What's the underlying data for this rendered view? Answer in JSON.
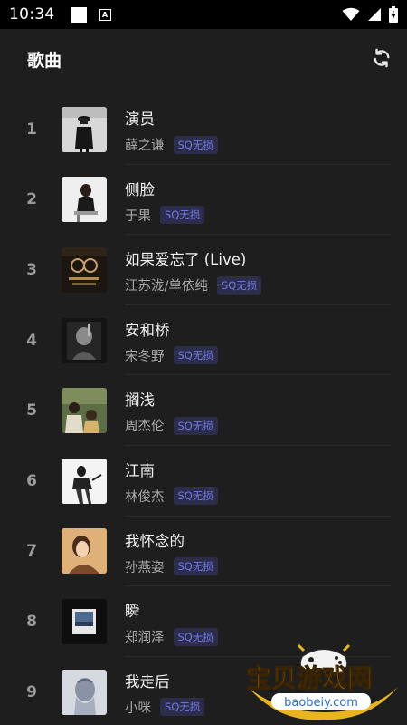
{
  "status_bar": {
    "time": "10:34",
    "notification_letter": "A"
  },
  "header": {
    "title": "歌曲",
    "refresh_icon": "refresh-icon"
  },
  "colors": {
    "background": "#1e1e1e",
    "badge_bg": "#2b2d4a",
    "badge_text": "#7279ea",
    "rank": "#9b9b9b",
    "artist": "#a9a9a9"
  },
  "songs": [
    {
      "rank": "1",
      "title": "演员",
      "artist": "薛之谦",
      "badge": "SQ无损"
    },
    {
      "rank": "2",
      "title": "侧脸",
      "artist": "于果",
      "badge": "SQ无损"
    },
    {
      "rank": "3",
      "title": "如果爱忘了 (Live)",
      "artist": "汪苏泷/单依纯",
      "badge": "SQ无损"
    },
    {
      "rank": "4",
      "title": "安和桥",
      "artist": "宋冬野",
      "badge": "SQ无损"
    },
    {
      "rank": "5",
      "title": "搁浅",
      "artist": "周杰伦",
      "badge": "SQ无损"
    },
    {
      "rank": "6",
      "title": "江南",
      "artist": "林俊杰",
      "badge": "SQ无损"
    },
    {
      "rank": "7",
      "title": "我怀念的",
      "artist": "孙燕姿",
      "badge": "SQ无损"
    },
    {
      "rank": "8",
      "title": "瞬",
      "artist": "郑润泽",
      "badge": "SQ无损"
    },
    {
      "rank": "9",
      "title": "我走后",
      "artist": "小咪",
      "badge": "SQ无损"
    }
  ],
  "watermark": {
    "brand": "宝贝游戏网",
    "site": "baobeiy.com"
  }
}
